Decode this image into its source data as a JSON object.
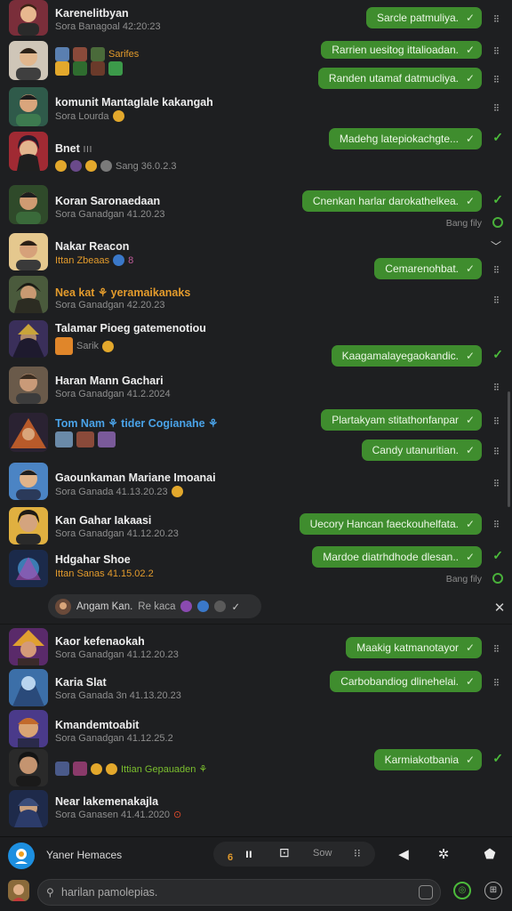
{
  "chats": [
    {
      "name": "Karenelitbyan",
      "sub": "Sora Banagoal 42:20:23",
      "bubble": "Sarcle patmuliya.",
      "status": "grip",
      "avatar": "#d9534f"
    },
    {
      "name": "Sarifes",
      "sub": "",
      "bubble": "Rarrien uesitog ittalioadan.",
      "bubble2": "Randen utamaf datmucliya.",
      "status": "grip",
      "avatar": "#c8a57a"
    },
    {
      "name": "komunit Mantaglale kakangah",
      "sub": "Sora Lourda",
      "bubble": "",
      "status": "grip",
      "avatar": "#3c8a66"
    },
    {
      "name": "Bnet",
      "sub": "Sang 36.0.2.3",
      "bubble": "Madehg latepiokachgte...",
      "status": "check",
      "avatar": "#8a2b3c"
    },
    {
      "name": "Koran Saronaedaan",
      "sub": "Sora Ganadgan 41.20.23",
      "bubble": "Cnenkan harlar darokathelkea.",
      "status": "check",
      "meta": "Bang fily",
      "avatar": "#4f8a3c"
    },
    {
      "name": "Nakar Reacon",
      "sub": "Ittan Zbeaas",
      "bubble": "Cemarenohbat.",
      "status": "grip",
      "avatar": "#d89a4a"
    },
    {
      "name": "Nea kat ⚘ yeramaikanaks",
      "sub": "Sora Ganadgan 42.20.23",
      "bubble": "",
      "status": "grip",
      "avatar": "#5a6b48"
    },
    {
      "name": "Talamar Pioeg gatemenotiou",
      "sub": "Sarik",
      "bubble": "Kaagamalayegaokandic.",
      "status": "check",
      "avatar": "#4b3f6a"
    },
    {
      "name": "Haran Mann Gachari",
      "sub": "Sora Ganadgan 41.2.2024",
      "bubble": "",
      "status": "grip",
      "avatar": "#6b4a3a"
    },
    {
      "name": "Tom Nam ⚘ tider Cogianahe ⚘",
      "sub": "",
      "bubble": "Plartakyam stitathonfanpar",
      "bubble2": "Candy utanuritian.",
      "status": "grip",
      "avatar": "#a8523a"
    },
    {
      "name": "Gaounkaman Mariane Imoanai",
      "sub": "Sora Ganada 41.13.20.23",
      "bubble": "",
      "status": "grip",
      "avatar": "#3d79b8"
    },
    {
      "name": "Kan Gahar Iakaasi",
      "sub": "Sora Ganadgan 41.12.20.23",
      "bubble": "Uecory Hancan faeckouhelfata.",
      "status": "grip",
      "avatar": "#d6a23c"
    },
    {
      "name": "Hdgahar Shoe",
      "sub": "Ittan Sanas 41.15.02.2",
      "bubble": "Mardoe diatrhdhode dlesan..",
      "status": "check",
      "meta": "Bang fily",
      "avatar": "#2c5a8a"
    },
    {
      "name": "Kaor kefenaokah",
      "sub": "Sora Ganadgan 41.12.20.23",
      "bubble": "Maakig katmanotayor",
      "status": "grip",
      "avatar": "#8a3c6e"
    },
    {
      "name": "Karia Slat",
      "sub": "Sora Ganada 3n 41.13.20.23",
      "bubble": "Carbobandiog dlinehelai.",
      "status": "grip",
      "avatar": "#3c6fa8"
    },
    {
      "name": "Kmandemtoabit",
      "sub": "Sora Ganadgan 41.12.25.2",
      "bubble": "",
      "status": "",
      "avatar": "#c26a2c"
    },
    {
      "name": "Ittian Gepauaden ⚘",
      "sub": "",
      "bubble": "Karmiakotbania",
      "status": "check",
      "avatar": "#3a3a3a"
    },
    {
      "name": "Near lakemenakajla",
      "sub": "Sora Ganasen 41.41.2020",
      "bubble": "",
      "status": "",
      "avatar": "#3b4d7a"
    }
  ],
  "reply": {
    "label": "Angam Kan.",
    "sub_label": "Re kaca"
  },
  "toolbar": {
    "title": "Yaner Hemaces",
    "seg_label": "Sow",
    "seg_count": "6"
  },
  "composer": {
    "placeholder": "harilan pamolepias."
  },
  "colors": {
    "bubble": "#3f8d2e",
    "background": "#1e1f21",
    "accent_orange": "#e39b2c"
  }
}
